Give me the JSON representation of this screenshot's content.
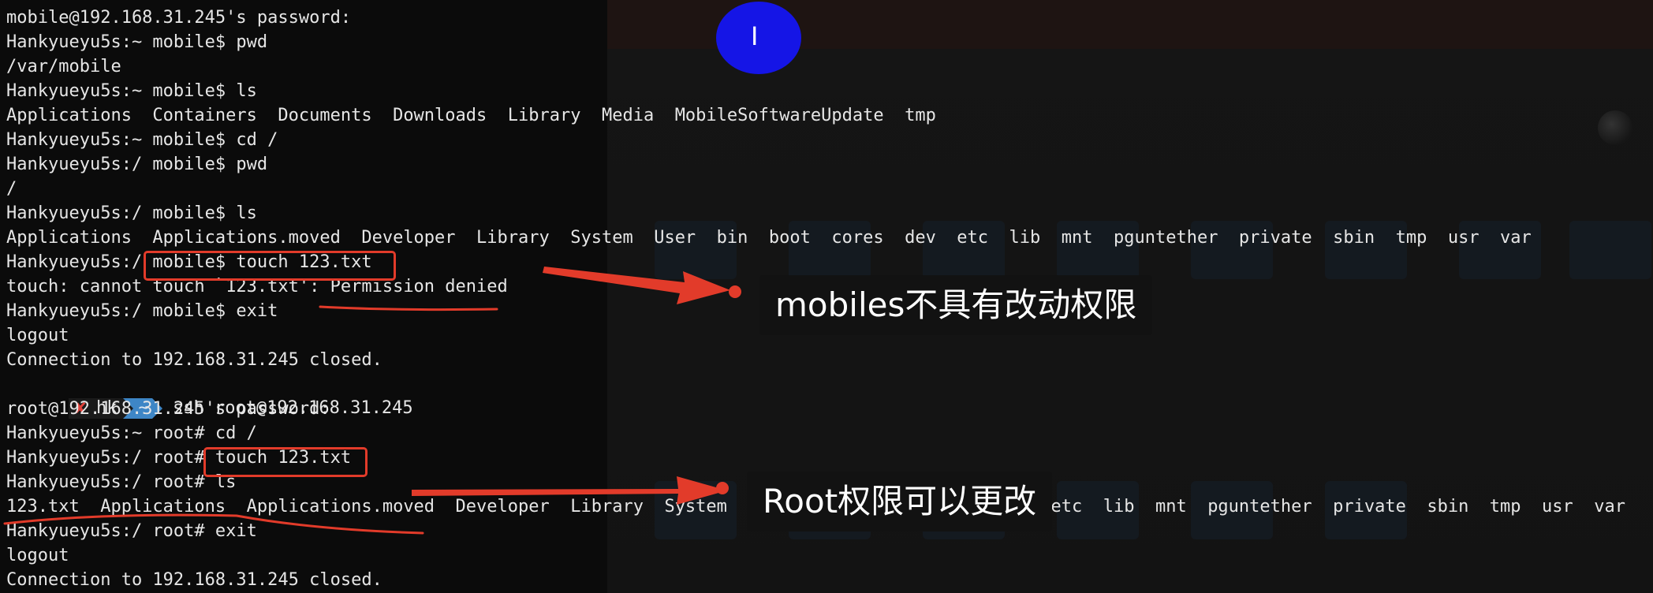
{
  "terminal": {
    "lines": [
      "mobile@192.168.31.245's password:",
      "Hankyueyu5s:~ mobile$ pwd",
      "/var/mobile",
      "Hankyueyu5s:~ mobile$ ls",
      "Applications  Containers  Documents  Downloads  Library  Media  MobileSoftwareUpdate  tmp",
      "Hankyueyu5s:~ mobile$ cd /",
      "Hankyueyu5s:/ mobile$ pwd",
      "/",
      "Hankyueyu5s:/ mobile$ ls",
      "Applications  Applications.moved  Developer  Library  System  User  bin  boot  cores  dev  etc  lib  mnt  pguntether  private  sbin  tmp  usr  var",
      "Hankyueyu5s:/ mobile$ touch 123.txt",
      "touch: cannot touch `123.txt': Permission denied",
      "Hankyueyu5s:/ mobile$ exit",
      "logout",
      "Connection to 192.168.31.245 closed.",
      "",
      "root@192.168.31.245's password:",
      "Hankyueyu5s:~ root# cd /",
      "Hankyueyu5s:/ root# touch 123.txt",
      "Hankyueyu5s:/ root# ls",
      "123.txt  Applications  Applications.moved  Developer  Library  System  User  bin  boot  cores  dev  etc  lib  mnt  pguntether  private  sbin  tmp  usr  var",
      "Hankyueyu5s:/ root# exit",
      "logout",
      "Connection to 192.168.31.245 closed."
    ],
    "shell_prompt": {
      "status_icon": "x-mark-icon",
      "status_glyph": "✘",
      "user": "hk",
      "dir": "~",
      "command": "ssh root@192.168.31.245"
    }
  },
  "annotations": {
    "mobile_callout": "mobiles不具有改动权限",
    "root_callout": "Root权限可以更改"
  },
  "cursor": {
    "glyph": "I",
    "icon": "text-cursor-icon"
  },
  "colors": {
    "terminal_text": "#e6e6e6",
    "annotation_red": "#e23b2a",
    "cursor_highlight_blue": "#1515e6",
    "prompt_blue": "#3e86c6",
    "prompt_x_red": "#e0413a"
  }
}
